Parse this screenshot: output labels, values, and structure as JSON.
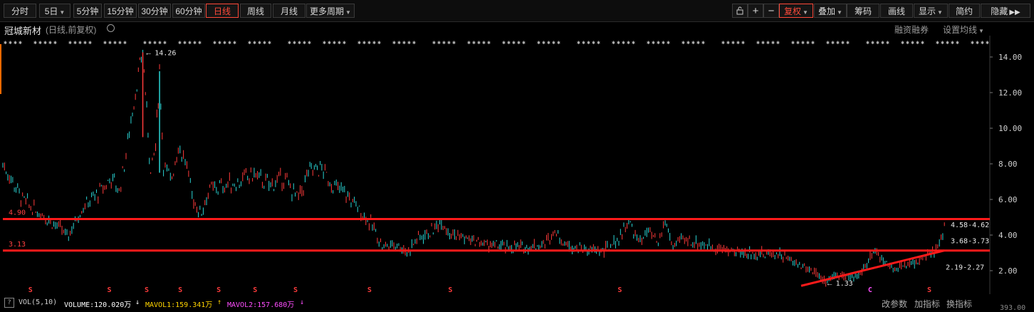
{
  "toolbar": {
    "periods": [
      "分时",
      "5日",
      "5分钟",
      "15分钟",
      "30分钟",
      "60分钟",
      "日线",
      "周线",
      "月线",
      "更多周期"
    ],
    "active_period": "日线",
    "right": [
      "复权",
      "叠加",
      "筹码",
      "画线",
      "显示",
      "简约",
      "隐藏"
    ],
    "active_right": "复权"
  },
  "header": {
    "stock_name": "冠城新材",
    "subtitle": "(日线,前复权)",
    "margin_link": "融资融券",
    "ma_link": "设置均线"
  },
  "chart_data": {
    "type": "line",
    "y_ticks": [
      "14.00",
      "12.00",
      "10.00",
      "8.00",
      "6.00",
      "4.00",
      "2.00"
    ],
    "ylim": [
      1.5,
      15.0
    ],
    "hlines": [
      {
        "label": "4.90",
        "value": 4.9,
        "color": "#ff1a1a"
      },
      {
        "label": "3.13",
        "value": 3.13,
        "color": "#ff1a1a"
      }
    ],
    "trendline": {
      "from": [
        0.81,
        1.15
      ],
      "to": [
        0.955,
        3.13
      ],
      "color": "#ff1a1a"
    },
    "annotations": [
      {
        "text": "14.26",
        "value": 14.26
      },
      {
        "text": "1.33",
        "value": 1.33
      },
      {
        "text": "4.58-4.62",
        "value": 4.6
      },
      {
        "text": "3.68-3.73",
        "value": 3.7
      },
      {
        "text": "2.19-2.27",
        "value": 2.23
      }
    ],
    "price_series": [
      {
        "x": 0.0,
        "y": 8.0
      },
      {
        "x": 0.01,
        "y": 7.0
      },
      {
        "x": 0.02,
        "y": 6.0
      },
      {
        "x": 0.03,
        "y": 5.5
      },
      {
        "x": 0.04,
        "y": 5.2
      },
      {
        "x": 0.05,
        "y": 4.7
      },
      {
        "x": 0.06,
        "y": 4.3
      },
      {
        "x": 0.065,
        "y": 3.9
      },
      {
        "x": 0.07,
        "y": 4.4
      },
      {
        "x": 0.08,
        "y": 5.5
      },
      {
        "x": 0.09,
        "y": 6.0
      },
      {
        "x": 0.1,
        "y": 6.5
      },
      {
        "x": 0.11,
        "y": 7.2
      },
      {
        "x": 0.118,
        "y": 6.5
      },
      {
        "x": 0.125,
        "y": 8.5
      },
      {
        "x": 0.13,
        "y": 10.5
      },
      {
        "x": 0.136,
        "y": 12.5
      },
      {
        "x": 0.142,
        "y": 14.26
      },
      {
        "x": 0.146,
        "y": 11.0
      },
      {
        "x": 0.15,
        "y": 7.5
      },
      {
        "x": 0.155,
        "y": 9.0
      },
      {
        "x": 0.159,
        "y": 13.2
      },
      {
        "x": 0.163,
        "y": 8.0
      },
      {
        "x": 0.17,
        "y": 7.0
      },
      {
        "x": 0.178,
        "y": 9.0
      },
      {
        "x": 0.185,
        "y": 8.2
      },
      {
        "x": 0.192,
        "y": 6.2
      },
      {
        "x": 0.2,
        "y": 5.2
      },
      {
        "x": 0.21,
        "y": 6.5
      },
      {
        "x": 0.225,
        "y": 6.8
      },
      {
        "x": 0.24,
        "y": 7.0
      },
      {
        "x": 0.255,
        "y": 7.4
      },
      {
        "x": 0.27,
        "y": 6.8
      },
      {
        "x": 0.285,
        "y": 7.2
      },
      {
        "x": 0.3,
        "y": 6.0
      },
      {
        "x": 0.31,
        "y": 7.5
      },
      {
        "x": 0.322,
        "y": 7.8
      },
      {
        "x": 0.335,
        "y": 6.8
      },
      {
        "x": 0.35,
        "y": 6.2
      },
      {
        "x": 0.365,
        "y": 5.2
      },
      {
        "x": 0.375,
        "y": 4.5
      },
      {
        "x": 0.385,
        "y": 3.4
      },
      {
        "x": 0.4,
        "y": 3.5
      },
      {
        "x": 0.41,
        "y": 3.0
      },
      {
        "x": 0.42,
        "y": 3.8
      },
      {
        "x": 0.435,
        "y": 4.2
      },
      {
        "x": 0.445,
        "y": 4.8
      },
      {
        "x": 0.455,
        "y": 4.1
      },
      {
        "x": 0.47,
        "y": 3.8
      },
      {
        "x": 0.49,
        "y": 3.5
      },
      {
        "x": 0.51,
        "y": 3.3
      },
      {
        "x": 0.53,
        "y": 3.3
      },
      {
        "x": 0.55,
        "y": 3.5
      },
      {
        "x": 0.56,
        "y": 4.3
      },
      {
        "x": 0.57,
        "y": 3.5
      },
      {
        "x": 0.59,
        "y": 3.2
      },
      {
        "x": 0.61,
        "y": 3.1
      },
      {
        "x": 0.625,
        "y": 3.8
      },
      {
        "x": 0.635,
        "y": 4.8
      },
      {
        "x": 0.645,
        "y": 3.6
      },
      {
        "x": 0.655,
        "y": 4.2
      },
      {
        "x": 0.665,
        "y": 3.5
      },
      {
        "x": 0.672,
        "y": 4.8
      },
      {
        "x": 0.68,
        "y": 3.3
      },
      {
        "x": 0.69,
        "y": 3.8
      },
      {
        "x": 0.7,
        "y": 3.6
      },
      {
        "x": 0.715,
        "y": 3.4
      },
      {
        "x": 0.73,
        "y": 3.2
      },
      {
        "x": 0.75,
        "y": 3.0
      },
      {
        "x": 0.77,
        "y": 2.9
      },
      {
        "x": 0.785,
        "y": 3.0
      },
      {
        "x": 0.795,
        "y": 2.7
      },
      {
        "x": 0.81,
        "y": 2.3
      },
      {
        "x": 0.825,
        "y": 1.9
      },
      {
        "x": 0.835,
        "y": 1.33
      },
      {
        "x": 0.845,
        "y": 1.8
      },
      {
        "x": 0.86,
        "y": 1.5
      },
      {
        "x": 0.875,
        "y": 2.2
      },
      {
        "x": 0.885,
        "y": 3.2
      },
      {
        "x": 0.895,
        "y": 2.5
      },
      {
        "x": 0.905,
        "y": 2.1
      },
      {
        "x": 0.915,
        "y": 2.3
      },
      {
        "x": 0.93,
        "y": 2.6
      },
      {
        "x": 0.945,
        "y": 3.0
      },
      {
        "x": 0.952,
        "y": 3.7
      },
      {
        "x": 0.957,
        "y": 4.9
      }
    ],
    "markers": [
      {
        "x": 0.028,
        "label": "S"
      },
      {
        "x": 0.108,
        "label": "S"
      },
      {
        "x": 0.146,
        "label": "S"
      },
      {
        "x": 0.18,
        "label": "S"
      },
      {
        "x": 0.219,
        "label": "S"
      },
      {
        "x": 0.256,
        "label": "S"
      },
      {
        "x": 0.297,
        "label": "S"
      },
      {
        "x": 0.372,
        "label": "S"
      },
      {
        "x": 0.454,
        "label": "S"
      },
      {
        "x": 0.626,
        "label": "S"
      },
      {
        "x": 0.88,
        "label": "C"
      },
      {
        "x": 0.94,
        "label": "S"
      }
    ]
  },
  "volume_bar": {
    "help": "?",
    "name": "VOL(5,10)",
    "volume": "VOLUME:120.020万",
    "volume_arrow": "↓",
    "mavol1": "MAVOL1:159.341万",
    "mavol1_arrow": "↑",
    "mavol2": "MAVOL2:157.680万",
    "mavol2_arrow": "↓",
    "links": [
      "改参数",
      "加指标",
      "换指标"
    ],
    "axis_value": "393.00"
  },
  "colors": {
    "up": "#ff3b3b",
    "down": "#2ad4d4",
    "line": "#ff1a1a",
    "mavol1": "#ffd400",
    "mavol2": "#ff4dff"
  }
}
